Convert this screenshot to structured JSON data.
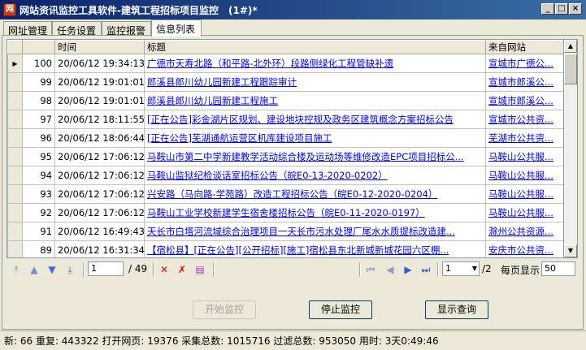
{
  "window": {
    "title": "网站资讯监控工具软件-建筑工程招标项目监控　(1#)*",
    "app_icon": "app-logo-icon",
    "minimize": "_",
    "maximize": "□",
    "close": "×"
  },
  "tabs": [
    {
      "label": "网址管理"
    },
    {
      "label": "任务设置"
    },
    {
      "label": "监控报警"
    },
    {
      "label": "信息列表"
    }
  ],
  "grid": {
    "columns": {
      "time": "时间",
      "title": "标题",
      "source": "来自网站"
    },
    "row_indicator": "▶",
    "rows": [
      {
        "id": "100",
        "time": "20/06/12 19:34:13",
        "title": "广德市天寿北路（和平路-北外环）段路侧绿化工程管缺补遗",
        "source": "宣城市广德公..."
      },
      {
        "id": "99",
        "time": "20/06/12 19:01:01",
        "title": "郎溪县郎川幼儿园新建工程跟踪审计",
        "source": "宣城市郎溪公..."
      },
      {
        "id": "98",
        "time": "20/06/12 19:01:01",
        "title": "郎溪县郎川幼儿园新建工程施工",
        "source": "宣城市郎溪公..."
      },
      {
        "id": "97",
        "time": "20/06/12 18:11:55",
        "title": "[正在公告]彩金湖片区规划、建设地块控规及政务区建筑概念方案招标公告",
        "source": "宣城市公共资..."
      },
      {
        "id": "96",
        "time": "20/06/12 18:06:44",
        "title": "[正在公告]芜湖通航运营区机库建设项目施工",
        "source": "芜湖市公共资..."
      },
      {
        "id": "95",
        "time": "20/06/12 17:06:12",
        "title": "马鞍山市第二中学新建教学活动综合楼及运动场等维修改造EPC项目招标公...",
        "source": "马鞍山公共服..."
      },
      {
        "id": "94",
        "time": "20/06/12 17:06:12",
        "title": "马鞍山监狱纪检谈话室招标公告（皖E0-13-2020-0202）",
        "source": "马鞍山公共服..."
      },
      {
        "id": "93",
        "time": "20/06/12 17:06:12",
        "title": "兴安路（马向路-学苑路）改造工程招标公告（皖E0-12-2020-0204）",
        "source": "马鞍山公共服..."
      },
      {
        "id": "92",
        "time": "20/06/12 17:06:12",
        "title": "马鞍山工业学校新建学生宿舍楼招标公告（皖E0-11-2020-0197）",
        "source": "马鞍山公共服..."
      },
      {
        "id": "91",
        "time": "20/06/12 16:49:43",
        "title": "天长市白塔河流域综合治理项目一天长市污水处理厂尾水水质提标改造建...",
        "source": "滁州公共资源..."
      },
      {
        "id": "89",
        "time": "20/06/12 16:31:34",
        "title": "【宿松县】[正在公告][公开招标][施工]宿松县东北新城新城花园六区棚...",
        "source": "安庆市公共资..."
      }
    ]
  },
  "navigator": {
    "first_icon": "move-first-icon",
    "prev_icon": "move-up-icon",
    "next_icon": "move-down-icon",
    "last_icon": "move-last-icon",
    "current_item": "1",
    "total_items": "/ 49",
    "delete_icon": "delete-icon",
    "delete_all_icon": "delete-all-icon",
    "clear_db_icon": "database-clear-icon",
    "page_first_icon": "first-page-icon",
    "page_prev_icon": "prev-page-icon",
    "page_next_icon": "next-page-icon",
    "page_last_icon": "last-page-icon",
    "page_value": "1",
    "page_total": "/2",
    "per_page_label": "每页显示",
    "per_page_value": "50"
  },
  "buttons": {
    "start": "开始监控",
    "stop": "停止监控",
    "show_query": "显示查询"
  },
  "status": {
    "text": "新: 66 重复: 443322 打开网页: 19376 采集总数: 1015716 过滤总数: 953050 用时: 3天0:49:46"
  },
  "colors": {
    "titlebar": "#0a246a",
    "link": "#0000ee",
    "window_bg": "#ece9d8"
  }
}
